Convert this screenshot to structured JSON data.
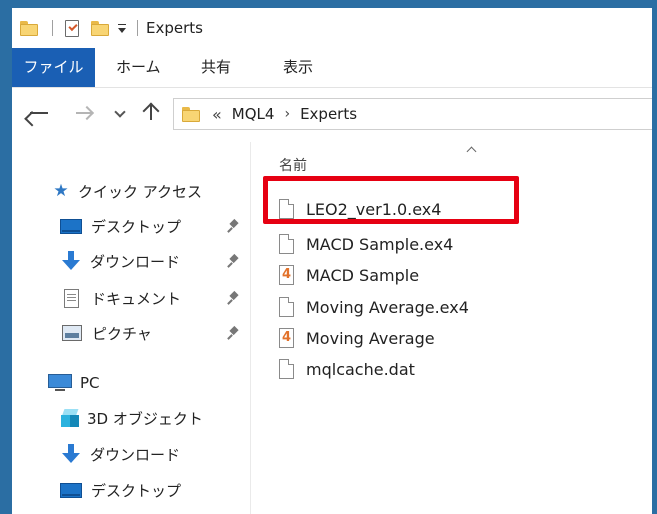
{
  "window": {
    "title": "Experts"
  },
  "ribbon": {
    "tabs": [
      "ファイル",
      "ホーム",
      "共有",
      "表示"
    ]
  },
  "address": {
    "overflow": "«",
    "crumbs": [
      "MQL4",
      "Experts"
    ]
  },
  "sidebar": {
    "quick_access": "クイック アクセス",
    "items": [
      {
        "label": "デスクトップ",
        "icon": "desktop-icon",
        "pinned": true
      },
      {
        "label": "ダウンロード",
        "icon": "download-icon",
        "pinned": true
      },
      {
        "label": "ドキュメント",
        "icon": "document-icon",
        "pinned": true
      },
      {
        "label": "ピクチャ",
        "icon": "pictures-icon",
        "pinned": true
      }
    ],
    "pc": "PC",
    "pc_items": [
      {
        "label": "3D オブジェクト",
        "icon": "3d-objects-icon"
      },
      {
        "label": "ダウンロード",
        "icon": "download-icon"
      },
      {
        "label": "デスクトップ",
        "icon": "desktop-icon"
      }
    ]
  },
  "filelist": {
    "column_name": "名前",
    "files": [
      {
        "name": "LEO2_ver1.0.ex4",
        "icon": "file-icon",
        "highlighted": true
      },
      {
        "name": "MACD Sample.ex4",
        "icon": "file-icon"
      },
      {
        "name": "MACD Sample",
        "icon": "mql4-source-icon"
      },
      {
        "name": "Moving Average.ex4",
        "icon": "file-icon"
      },
      {
        "name": "Moving Average",
        "icon": "mql4-source-icon"
      },
      {
        "name": "mqlcache.dat",
        "icon": "file-icon"
      }
    ],
    "mql_glyph": "4"
  },
  "colors": {
    "accent": "#1a5fb4",
    "highlight_box": "#e60012",
    "desktop_bg": "#2b6ea3"
  }
}
